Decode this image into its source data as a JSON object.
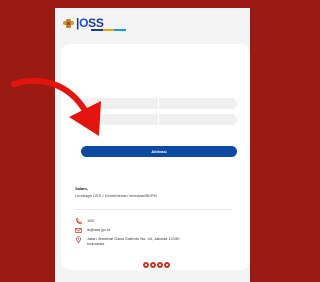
{
  "header": {
    "logo_text_prefix": "|",
    "logo_text_o": "O",
    "logo_text_rest": "SS"
  },
  "form": {
    "field1_placeholder": "",
    "field2_placeholder": ""
  },
  "actions": {
    "activate_label": "Aktivasi"
  },
  "footer": {
    "greeting": "Salam,",
    "signature": "Lembaga OSS • Kementerian Investasi/BKPM",
    "phone": "155",
    "email": "ik@oss.go.id",
    "address_line1": "Jalan Jenderal Gatot Subroto No. 44, Jakarta 12190",
    "address_line2": "Indonesia"
  },
  "social": [
    "instagram-icon",
    "facebook-icon",
    "twitter-icon",
    "youtube-icon"
  ],
  "colors": {
    "background": "#9a1b14",
    "primary": "#0b4aa2",
    "accent": "#c0392b",
    "arrow": "#e3140e"
  }
}
